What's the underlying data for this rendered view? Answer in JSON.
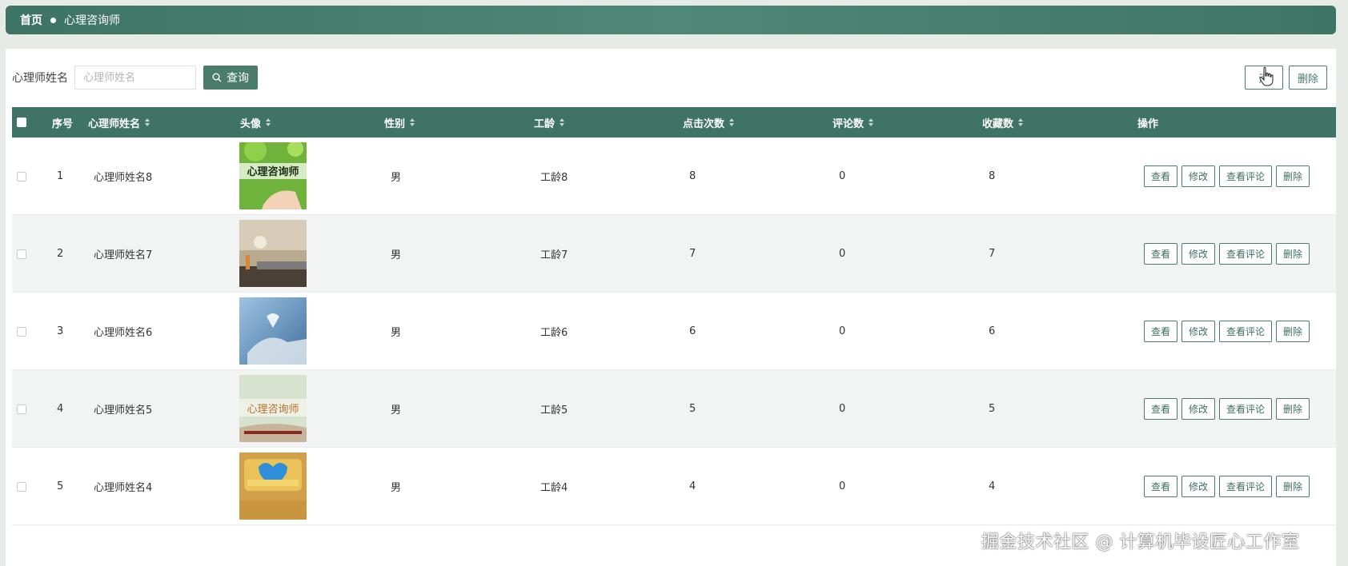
{
  "breadcrumb": {
    "home": "首页",
    "current": "心理咨询师"
  },
  "search": {
    "label": "心理师姓名",
    "placeholder": "心理师姓名",
    "button_label": "查询"
  },
  "toolbar": {
    "add_label": "添",
    "delete_label": "删除"
  },
  "table": {
    "headers": {
      "index": "序号",
      "name": "心理师姓名",
      "avatar": "头像",
      "gender": "性别",
      "seniority": "工龄",
      "clicks": "点击次数",
      "comments": "评论数",
      "favorites": "收藏数",
      "actions": "操作"
    },
    "rows": [
      {
        "index": "1",
        "name": "心理师姓名8",
        "gender": "男",
        "seniority": "工龄8",
        "clicks": "8",
        "comments": "0",
        "favorites": "8",
        "avatar_text": "心理咨询师"
      },
      {
        "index": "2",
        "name": "心理师姓名7",
        "gender": "男",
        "seniority": "工龄7",
        "clicks": "7",
        "comments": "0",
        "favorites": "7",
        "avatar_text": ""
      },
      {
        "index": "3",
        "name": "心理师姓名6",
        "gender": "男",
        "seniority": "工龄6",
        "clicks": "6",
        "comments": "0",
        "favorites": "6",
        "avatar_text": ""
      },
      {
        "index": "4",
        "name": "心理师姓名5",
        "gender": "男",
        "seniority": "工龄5",
        "clicks": "5",
        "comments": "0",
        "favorites": "5",
        "avatar_text": "心理咨询师"
      },
      {
        "index": "5",
        "name": "心理师姓名4",
        "gender": "男",
        "seniority": "工龄4",
        "clicks": "4",
        "comments": "0",
        "favorites": "4",
        "avatar_text": ""
      }
    ],
    "action_labels": {
      "view": "查看",
      "edit": "修改",
      "view_comments": "查看评论",
      "delete": "删除"
    }
  },
  "watermark": "掘金技术社区 @ 计算机毕设匠心工作室",
  "colors": {
    "accent": "#4a7c6c",
    "header_bg": "#3f7464"
  }
}
